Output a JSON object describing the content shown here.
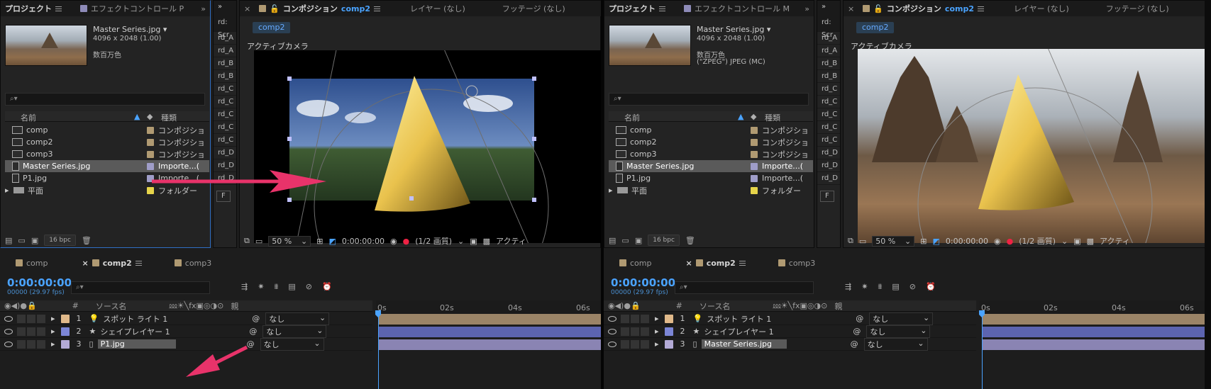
{
  "project": {
    "tab_project": "プロジェクト",
    "tab_effect_left": "エフェクトコントロール P",
    "tab_effect_right": "エフェクトコントロール M",
    "file_name": "Master Series.jpg ▾",
    "file_dims": "4096 x 2048 (1.00)",
    "file_colors": "数百万色",
    "file_codec": "(\"ZPEG\") JPEG (MC)",
    "search_placeholder": "⌕▾",
    "col_name": "名前",
    "col_type": "種類",
    "items": [
      {
        "name": "comp",
        "type": "コンポジショ",
        "kind": "comp"
      },
      {
        "name": "comp2",
        "type": "コンポジショ",
        "kind": "comp"
      },
      {
        "name": "comp3",
        "type": "コンポジショ",
        "kind": "comp"
      },
      {
        "name": "Master Series.jpg",
        "type": "Importe...(",
        "kind": "file"
      },
      {
        "name": "P1.jpg",
        "type": "Importe...(",
        "kind": "file"
      },
      {
        "name": "平面",
        "type": "フォルダー",
        "kind": "folder"
      }
    ],
    "bpc": "16 bpc"
  },
  "script_strip": {
    "header": "rd: Scr",
    "items": [
      "rd_A",
      "rd_A",
      "rd_B",
      "rd_B",
      "rd_C",
      "rd_C",
      "rd_C",
      "rd_C",
      "rd_C",
      "rd_D",
      "rd_D",
      "rd_D"
    ],
    "footer": "F"
  },
  "viewer": {
    "tab_comp": "コンポジション",
    "tab_comp_name": "comp2",
    "tab_layer": "レイヤー (なし)",
    "tab_footage": "フッテージ (なし)",
    "comp_chip": "comp2",
    "camera_label": "アクティブカメラ",
    "zoom": "50 %",
    "timecode": "0:00:00:00",
    "resolution": "(1/2 画質)",
    "camera_dd": "アクティ"
  },
  "timeline": {
    "tabs": [
      "comp",
      "comp2",
      "comp3"
    ],
    "timecode": "0:00:00:00",
    "fps": "00000 (29.97 fps)",
    "search_placeholder": "⌕▾",
    "col_num": "#",
    "col_source": "ソース名",
    "col_parent": "親",
    "ruler": [
      "0s",
      "02s",
      "04s",
      "06s"
    ],
    "layers_left": [
      {
        "num": "1",
        "name": "スポット ライト 1",
        "parent": "なし",
        "color": "#e0b98a"
      },
      {
        "num": "2",
        "name": "シェイプレイヤー 1",
        "parent": "なし",
        "color": "#7c86d6"
      },
      {
        "num": "3",
        "name": "P1.jpg",
        "parent": "なし",
        "color": "#b3aad6"
      }
    ],
    "layers_right": [
      {
        "num": "1",
        "name": "スポット ライト 1",
        "parent": "なし",
        "color": "#e0b98a"
      },
      {
        "num": "2",
        "name": "シェイプレイヤー 1",
        "parent": "なし",
        "color": "#7c86d6"
      },
      {
        "num": "3",
        "name": "Master Series.jpg",
        "parent": "なし",
        "color": "#b3aad6"
      }
    ]
  },
  "colors": {
    "accent": "#4aa3ff",
    "arrow": "#e8336a",
    "selection": "#5a5a5a"
  }
}
